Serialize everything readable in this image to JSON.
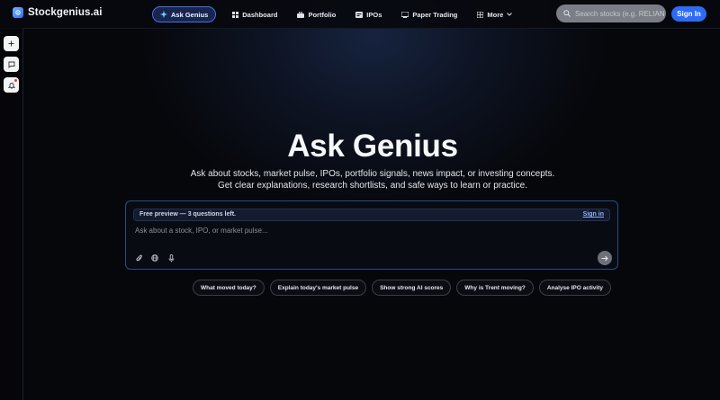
{
  "brand": {
    "name": "Stockgenius.ai",
    "logo_icon": "brain-logo-icon"
  },
  "nav": {
    "items": [
      {
        "label": "Ask Genius",
        "icon": "sparkle-icon",
        "active": true
      },
      {
        "label": "Dashboard",
        "icon": "grid-icon",
        "active": false
      },
      {
        "label": "Portfolio",
        "icon": "briefcase-icon",
        "active": false
      },
      {
        "label": "IPOs",
        "icon": "ipo-icon",
        "active": false
      },
      {
        "label": "Paper Trading",
        "icon": "monitor-icon",
        "active": false
      },
      {
        "label": "More",
        "icon": "apps-icon",
        "active": false
      }
    ]
  },
  "search": {
    "placeholder": "Search stocks (e.g. RELIANCE)"
  },
  "header": {
    "signin_label": "Sign In"
  },
  "rail": {
    "items": [
      "plus-icon",
      "chat-icon",
      "bell-icon"
    ]
  },
  "hero": {
    "title": "Ask Genius",
    "subtitle": "Ask about stocks, market pulse, IPOs, portfolio signals, news impact, or investing concepts. Get clear explanations, research shortlists, and safe ways to learn or practice."
  },
  "askbox": {
    "preview_text": "Free preview — 3 questions left.",
    "preview_signin": "Sign in",
    "placeholder": "Ask about a stock, IPO, or market pulse..."
  },
  "chips": [
    "What moved today?",
    "Explain today's market pulse",
    "Show strong AI scores",
    "Why is Trent moving?",
    "Analyse IPO activity"
  ],
  "colors": {
    "accent": "#2d6bf5",
    "background": "#06070b"
  }
}
